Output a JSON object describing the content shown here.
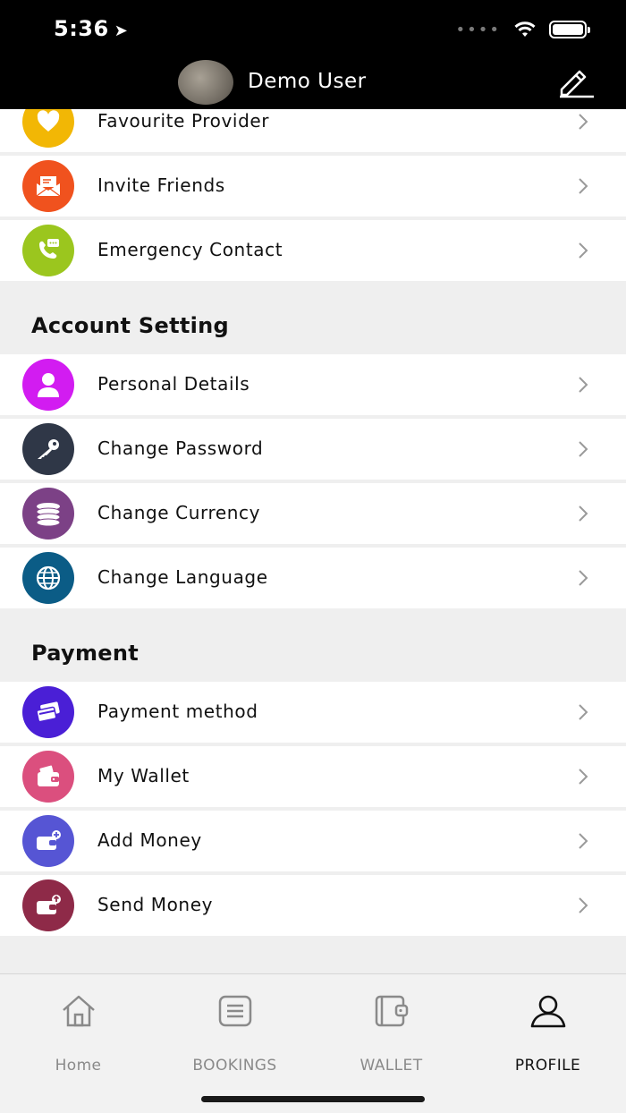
{
  "status_bar": {
    "time": "5:36"
  },
  "header": {
    "user_name": "Demo User"
  },
  "top_rows": [
    {
      "label": "Favourite Provider",
      "color": "#F2B705",
      "icon": "heart-icon"
    },
    {
      "label": "Invite Friends",
      "color": "#F0521E",
      "icon": "envelope-icon"
    },
    {
      "label": "Emergency Contact",
      "color": "#9BC61E",
      "icon": "phone-chat-icon"
    }
  ],
  "account_setting": {
    "title": "Account Setting",
    "rows": [
      {
        "label": "Personal Details",
        "color": "#D21CF1",
        "icon": "person-icon"
      },
      {
        "label": "Change Password",
        "color": "#2F3747",
        "icon": "key-icon"
      },
      {
        "label": "Change Currency",
        "color": "#7C4186",
        "icon": "coins-icon"
      },
      {
        "label": "Change Language",
        "color": "#0B5C86",
        "icon": "globe-icon"
      }
    ]
  },
  "payment": {
    "title": "Payment",
    "rows": [
      {
        "label": "Payment method",
        "color": "#4A1FD6",
        "icon": "cards-icon"
      },
      {
        "label": "My Wallet",
        "color": "#DB4F7E",
        "icon": "wallet-icon"
      },
      {
        "label": "Add Money",
        "color": "#5655D4",
        "icon": "wallet-add-icon"
      },
      {
        "label": "Send Money",
        "color": "#8E2A48",
        "icon": "wallet-send-icon"
      }
    ]
  },
  "bottom_nav": [
    {
      "label": "Home",
      "icon": "home-icon",
      "active": false
    },
    {
      "label": "BOOKINGS",
      "icon": "list-icon",
      "active": false
    },
    {
      "label": "WALLET",
      "icon": "wallet-icon",
      "active": false
    },
    {
      "label": "PROFILE",
      "icon": "person-outline-icon",
      "active": true
    }
  ]
}
